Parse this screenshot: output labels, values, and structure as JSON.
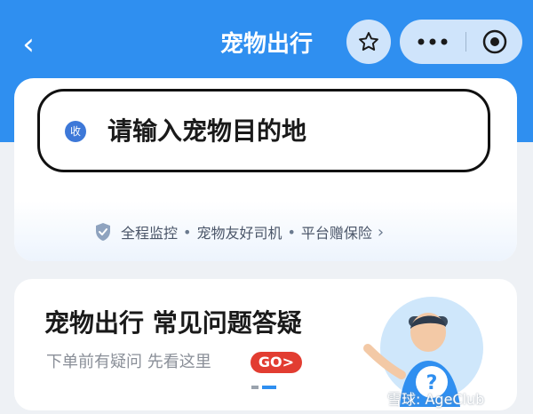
{
  "header": {
    "back_label": "‹",
    "title": "宠物出行"
  },
  "search": {
    "icon_text": "收",
    "placeholder": "请输入宠物目的地"
  },
  "features": {
    "items": [
      "全程监控",
      "宠物友好司机",
      "平台赠保险"
    ]
  },
  "faq": {
    "title": "宠物出行 常见问题答疑",
    "subtitle": "下单前有疑问 先看这里",
    "go_label": "GO>"
  },
  "watermark": {
    "text": "雪球: AgeClub"
  },
  "colors": {
    "header_blue": "#2f8ff0",
    "accent_red": "#e23d31",
    "search_icon_blue": "#3d78d8"
  }
}
